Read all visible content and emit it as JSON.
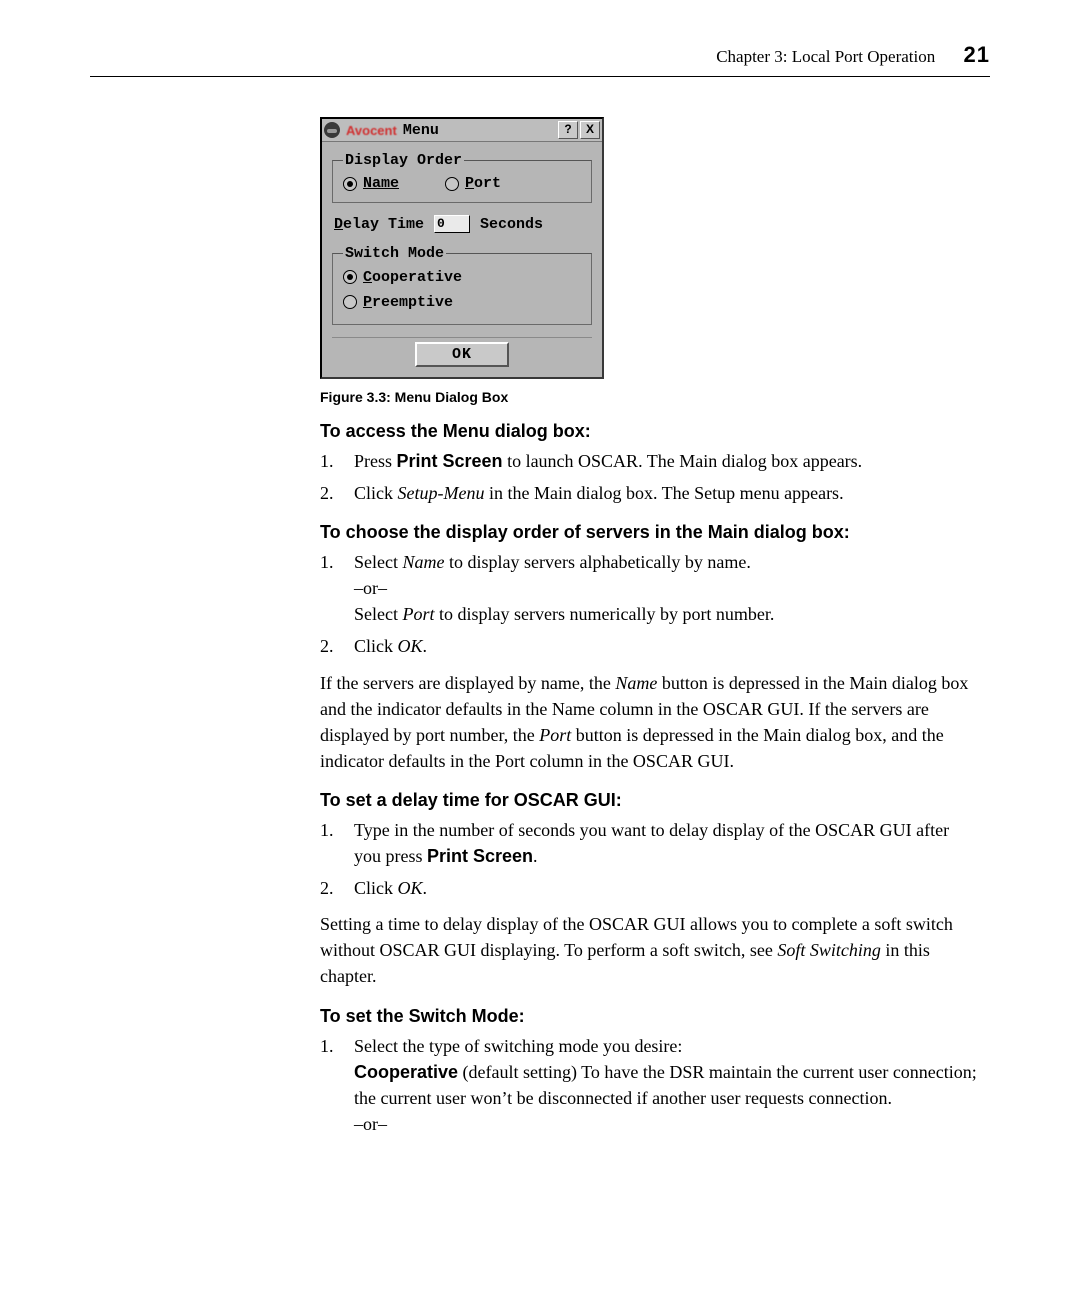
{
  "header": {
    "chapter": "Chapter 3: Local Port Operation",
    "page": "21"
  },
  "dialog": {
    "brand": "Avocent",
    "title": "Menu",
    "help_btn": "?",
    "close_btn": "X",
    "display_order": {
      "legend": "Display Order",
      "name": "Name",
      "port": "Port"
    },
    "delay": {
      "label": "Delay Time",
      "value": "0",
      "unit": "Seconds"
    },
    "switch_mode": {
      "legend": "Switch Mode",
      "cooperative": "Cooperative",
      "preemptive": "Preemptive"
    },
    "ok": "OK"
  },
  "caption": "Figure 3.3: Menu Dialog Box",
  "sec1": {
    "head": "To access the Menu dialog box:",
    "s1a": "Press ",
    "s1b": "Print Screen",
    "s1c": " to launch OSCAR. The Main dialog box appears.",
    "s2a": "Click ",
    "s2b": "Setup-Menu",
    "s2c": " in the Main dialog box. The Setup menu appears."
  },
  "sec2": {
    "head": "To choose the display order of servers in the Main dialog box:",
    "s1a": "Select ",
    "s1b": "Name",
    "s1c": " to display servers alphabetically by name.",
    "or": "–or–",
    "s1d": "Select ",
    "s1e": "Port",
    "s1f": " to display servers numerically by port number.",
    "s2a": "Click ",
    "s2b": "OK",
    "s2c": "."
  },
  "para1a": "If the servers are displayed by name, the ",
  "para1b": "Name",
  "para1c": " button is depressed in the Main dialog box and the indicator defaults in the Name column in the OSCAR GUI. If the servers are displayed by port number, the ",
  "para1d": "Port",
  "para1e": " button is depressed in the Main dialog box, and the indicator defaults in the Port column in the OSCAR GUI.",
  "sec3": {
    "head": "To set a delay time for OSCAR GUI:",
    "s1a": "Type in the number of seconds you want to delay display of the OSCAR GUI after you press ",
    "s1b": "Print Screen",
    "s1c": ".",
    "s2a": "Click ",
    "s2b": "OK",
    "s2c": "."
  },
  "para2a": "Setting a time to delay display of the OSCAR GUI allows you to complete a soft switch without OSCAR GUI displaying. To perform a soft switch, see ",
  "para2b": "Soft Switching",
  "para2c": " in this chapter.",
  "sec4": {
    "head": "To set the Switch Mode:",
    "s1a": "Select the type of switching mode you desire:",
    "s1b": "Cooperative",
    "s1c": " (default setting) To have the DSR maintain the current user connection; the current user won’t be disconnected if another user requests connection.",
    "or": "–or–"
  }
}
